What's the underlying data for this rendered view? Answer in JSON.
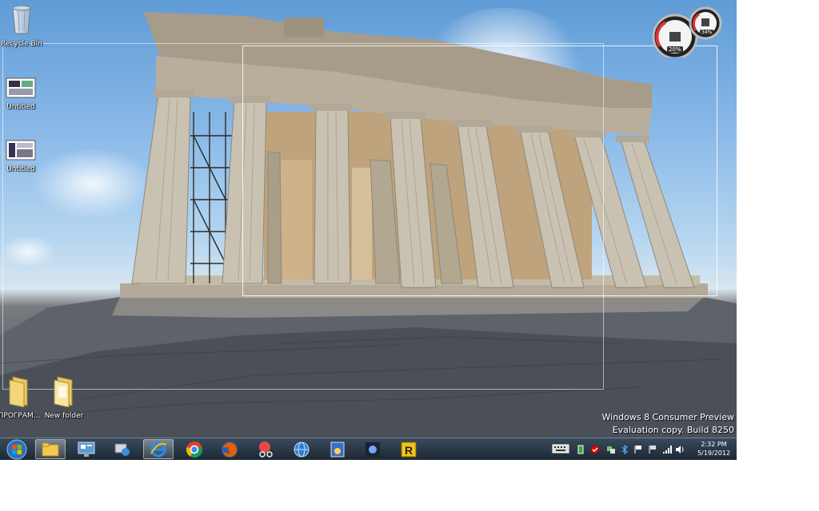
{
  "desktop": {
    "icons": [
      {
        "label": "Recycle Bin",
        "icon": "recycle-bin-icon"
      },
      {
        "label": "Untitled",
        "icon": "image-file-icon"
      },
      {
        "label": "Untitled",
        "icon": "image-file-icon"
      },
      {
        "label": "ПРОГРАМ...",
        "icon": "folder-icon"
      },
      {
        "label": "New folder",
        "icon": "folder-icon"
      }
    ],
    "watermark": {
      "line1": "Windows 8 Consumer Preview",
      "line2": "Evaluation copy. Build 8250"
    },
    "gadget": {
      "cpu_percent": "20%",
      "mem_percent": "34%"
    }
  },
  "taskbar": {
    "start_icon": "windows-orb-icon",
    "pinned": [
      {
        "name": "explorer",
        "icon": "folder-icon",
        "active": true
      },
      {
        "name": "control-panel",
        "icon": "control-panel-icon",
        "active": false
      },
      {
        "name": "network",
        "icon": "network-icon",
        "active": false
      },
      {
        "name": "internet-explorer",
        "icon": "ie-icon",
        "active": true
      },
      {
        "name": "chrome",
        "icon": "chrome-icon",
        "active": false
      },
      {
        "name": "firefox",
        "icon": "firefox-icon",
        "active": false
      },
      {
        "name": "snipping-tool",
        "icon": "scissors-icon",
        "active": false
      },
      {
        "name": "globe-app",
        "icon": "globe-icon",
        "active": false
      },
      {
        "name": "media-app",
        "icon": "media-icon",
        "active": false
      },
      {
        "name": "game-app",
        "icon": "game-icon",
        "active": false
      },
      {
        "name": "app-r",
        "icon": "r-app-icon",
        "active": false
      }
    ],
    "tray_icons": [
      "keyboard-icon",
      "battery-icon",
      "antivirus-icon",
      "network-tray-icon",
      "bluetooth-icon",
      "flag-icon",
      "action-center-icon",
      "signal-icon",
      "volume-icon"
    ],
    "clock": {
      "time": "2:32 PM",
      "date": "5/19/2012"
    }
  }
}
